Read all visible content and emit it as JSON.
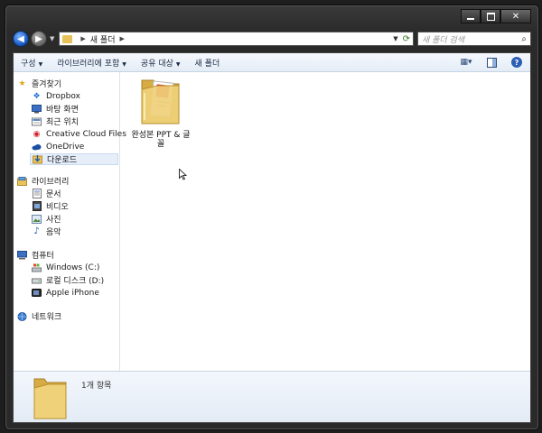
{
  "window": {
    "address": {
      "crumb": "새 폴더"
    },
    "search": {
      "placeholder": "새 폴더 검색"
    }
  },
  "toolbar": {
    "organize": "구성",
    "include_in_library": "라이브러리에 포함",
    "share_with": "공유 대상",
    "new_folder": "새 폴더"
  },
  "nav_pane": {
    "favorites": {
      "label": "즐겨찾기",
      "items": [
        "Dropbox",
        "바탕 화면",
        "최근 위치",
        "Creative Cloud Files",
        "OneDrive",
        "다운로드"
      ]
    },
    "libraries": {
      "label": "라이브러리",
      "items": [
        "문서",
        "비디오",
        "사진",
        "음악"
      ]
    },
    "computer": {
      "label": "컴퓨터",
      "items": [
        "Windows (C:)",
        "로컬 디스크 (D:)",
        "Apple iPhone"
      ]
    },
    "network": {
      "label": "네트워크"
    }
  },
  "content": {
    "items": [
      {
        "name": "완성본 PPT & 글꼴"
      }
    ]
  },
  "details_pane": {
    "count": "1개 항목"
  },
  "colors": {
    "accent": "#2c5fb3",
    "folder": "#e9c25b",
    "selected_bg": "#e6eefa"
  }
}
